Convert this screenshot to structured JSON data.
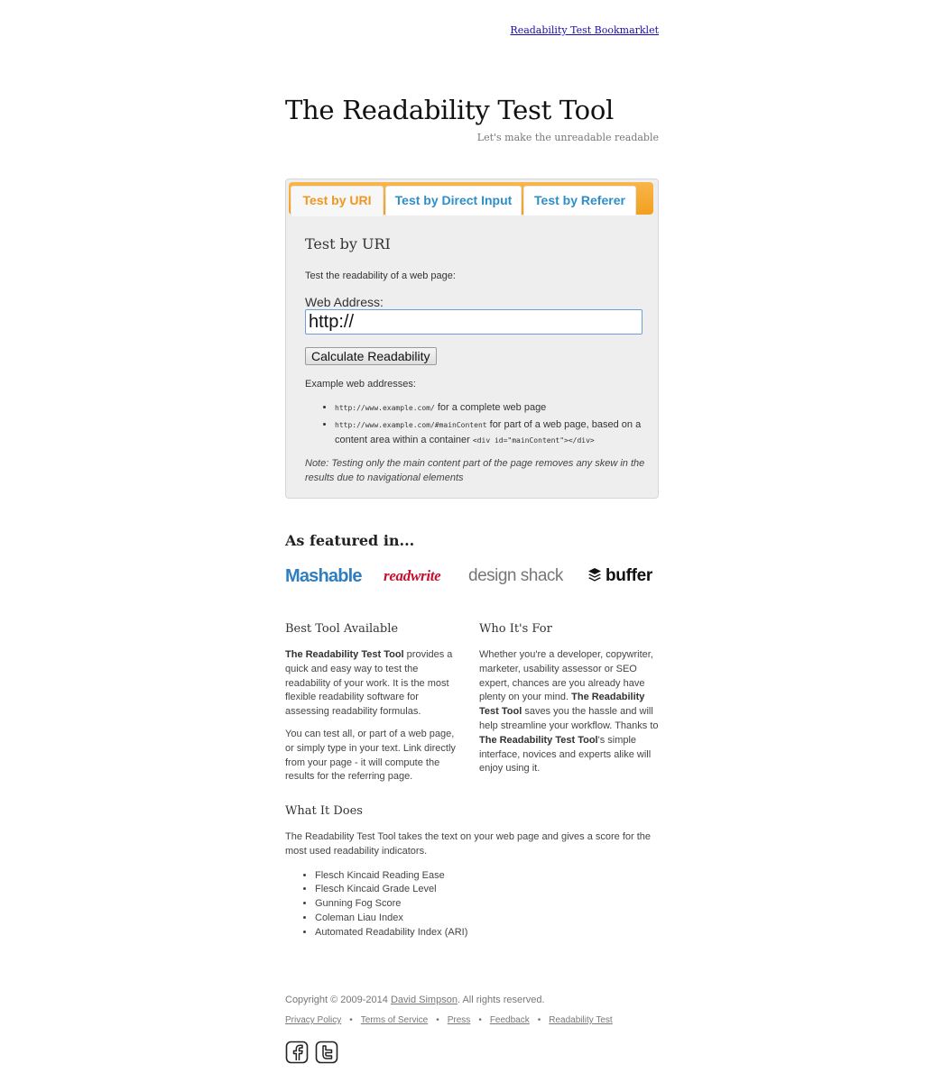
{
  "header": {
    "bookmarklet_link": "Readability Test Bookmarklet",
    "title": "The Readability Test Tool",
    "subtitle": "Let's make the unreadable readable"
  },
  "tabs": [
    {
      "label": "Test by URI",
      "active": true
    },
    {
      "label": "Test by Direct Input",
      "active": false
    },
    {
      "label": "Test by Referer",
      "active": false
    }
  ],
  "panel": {
    "heading": "Test by URI",
    "intro": "Test the readability of a web page:",
    "field_label": "Web Address:",
    "field_value": "http://",
    "button_label": "Calculate Readability",
    "examples_title": "Example web addresses:",
    "example1_code": "http://www.example.com/",
    "example1_text": " for a complete web page",
    "example2_code": "http://www.example.com/#mainContent",
    "example2_text": " for part of a web page, based on a content area within a container ",
    "example2_code2": "<div id=\"mainContent\"></div>",
    "note": "Note: Testing only the main content part of the page removes any skew in the results due to navigational elements"
  },
  "featured": {
    "title": "As featured in...",
    "logos": [
      "Mashable",
      "readwrite",
      "design shack",
      "buffer"
    ]
  },
  "best_tool": {
    "heading": "Best Tool Available",
    "p1_bold": "The Readability Test Tool",
    "p1_rest": " provides a quick and easy way to test the readability of your work. It is the most flexible readability software for assessing readability formulas.",
    "p2": "You can test all, or part of a web page, or simply type in your text. Link directly from your page - it will compute the results for the referring page."
  },
  "who_for": {
    "heading": "Who It's For",
    "t1": "Whether you're a developer, copywriter, marketer, usability assessor or SEO expert, chances are you already have plenty on your mind. ",
    "b1": "The Readability Test Tool",
    "t2": " saves you the hassle and will help streamline your workflow. Thanks to ",
    "b2": "The Readability Test Tool",
    "t3": "'s simple interface, novices and experts alike will enjoy using it."
  },
  "what_it_does": {
    "heading": "What It Does",
    "text": "The Readability Test Tool takes the text on your web page and gives a score for the most used readability indicators.",
    "indicators": [
      "Flesch Kincaid Reading Ease",
      "Flesch Kincaid Grade Level",
      "Gunning Fog Score",
      "Coleman Liau Index",
      "Automated Readability Index (ARI)"
    ]
  },
  "footer": {
    "copyright_pre": "Copyright © 2009-2014 ",
    "copyright_link": "David Simpson",
    "copyright_post": ". All rights reserved.",
    "links": [
      "Privacy Policy",
      "Terms of Service",
      "Press",
      "Feedback",
      "Readability Test"
    ],
    "separator": "•",
    "social_icons": [
      "facebook-icon",
      "twitter-icon"
    ]
  }
}
